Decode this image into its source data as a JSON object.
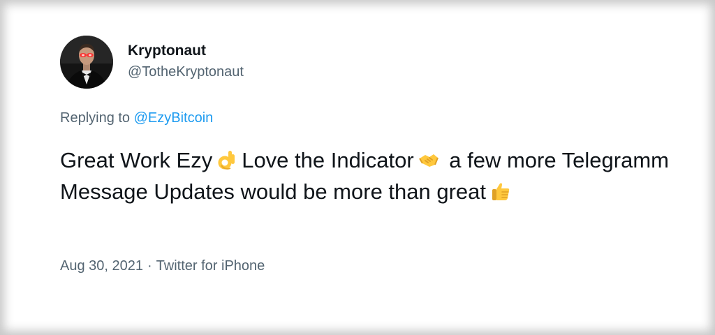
{
  "author": {
    "display_name": "Kryptonaut",
    "handle": "@TotheKryptonaut"
  },
  "reply": {
    "prefix": "Replying to",
    "mention": "@EzyBitcoin"
  },
  "tweet": {
    "segments": [
      "Great Work Ezy",
      "Love the Indicator",
      "a few more Telegramm Message Updates would be more than great"
    ],
    "emojis": [
      "ok-hand-emoji",
      "handshake-emoji",
      "thumbs-up-emoji"
    ]
  },
  "meta": {
    "date": "Aug 30, 2021",
    "separator": "·",
    "source": "Twitter for iPhone"
  },
  "colors": {
    "text_primary": "#0f1419",
    "text_secondary": "#536471",
    "link": "#1d9bf0",
    "emoji_yellow": "#ffc83d"
  }
}
